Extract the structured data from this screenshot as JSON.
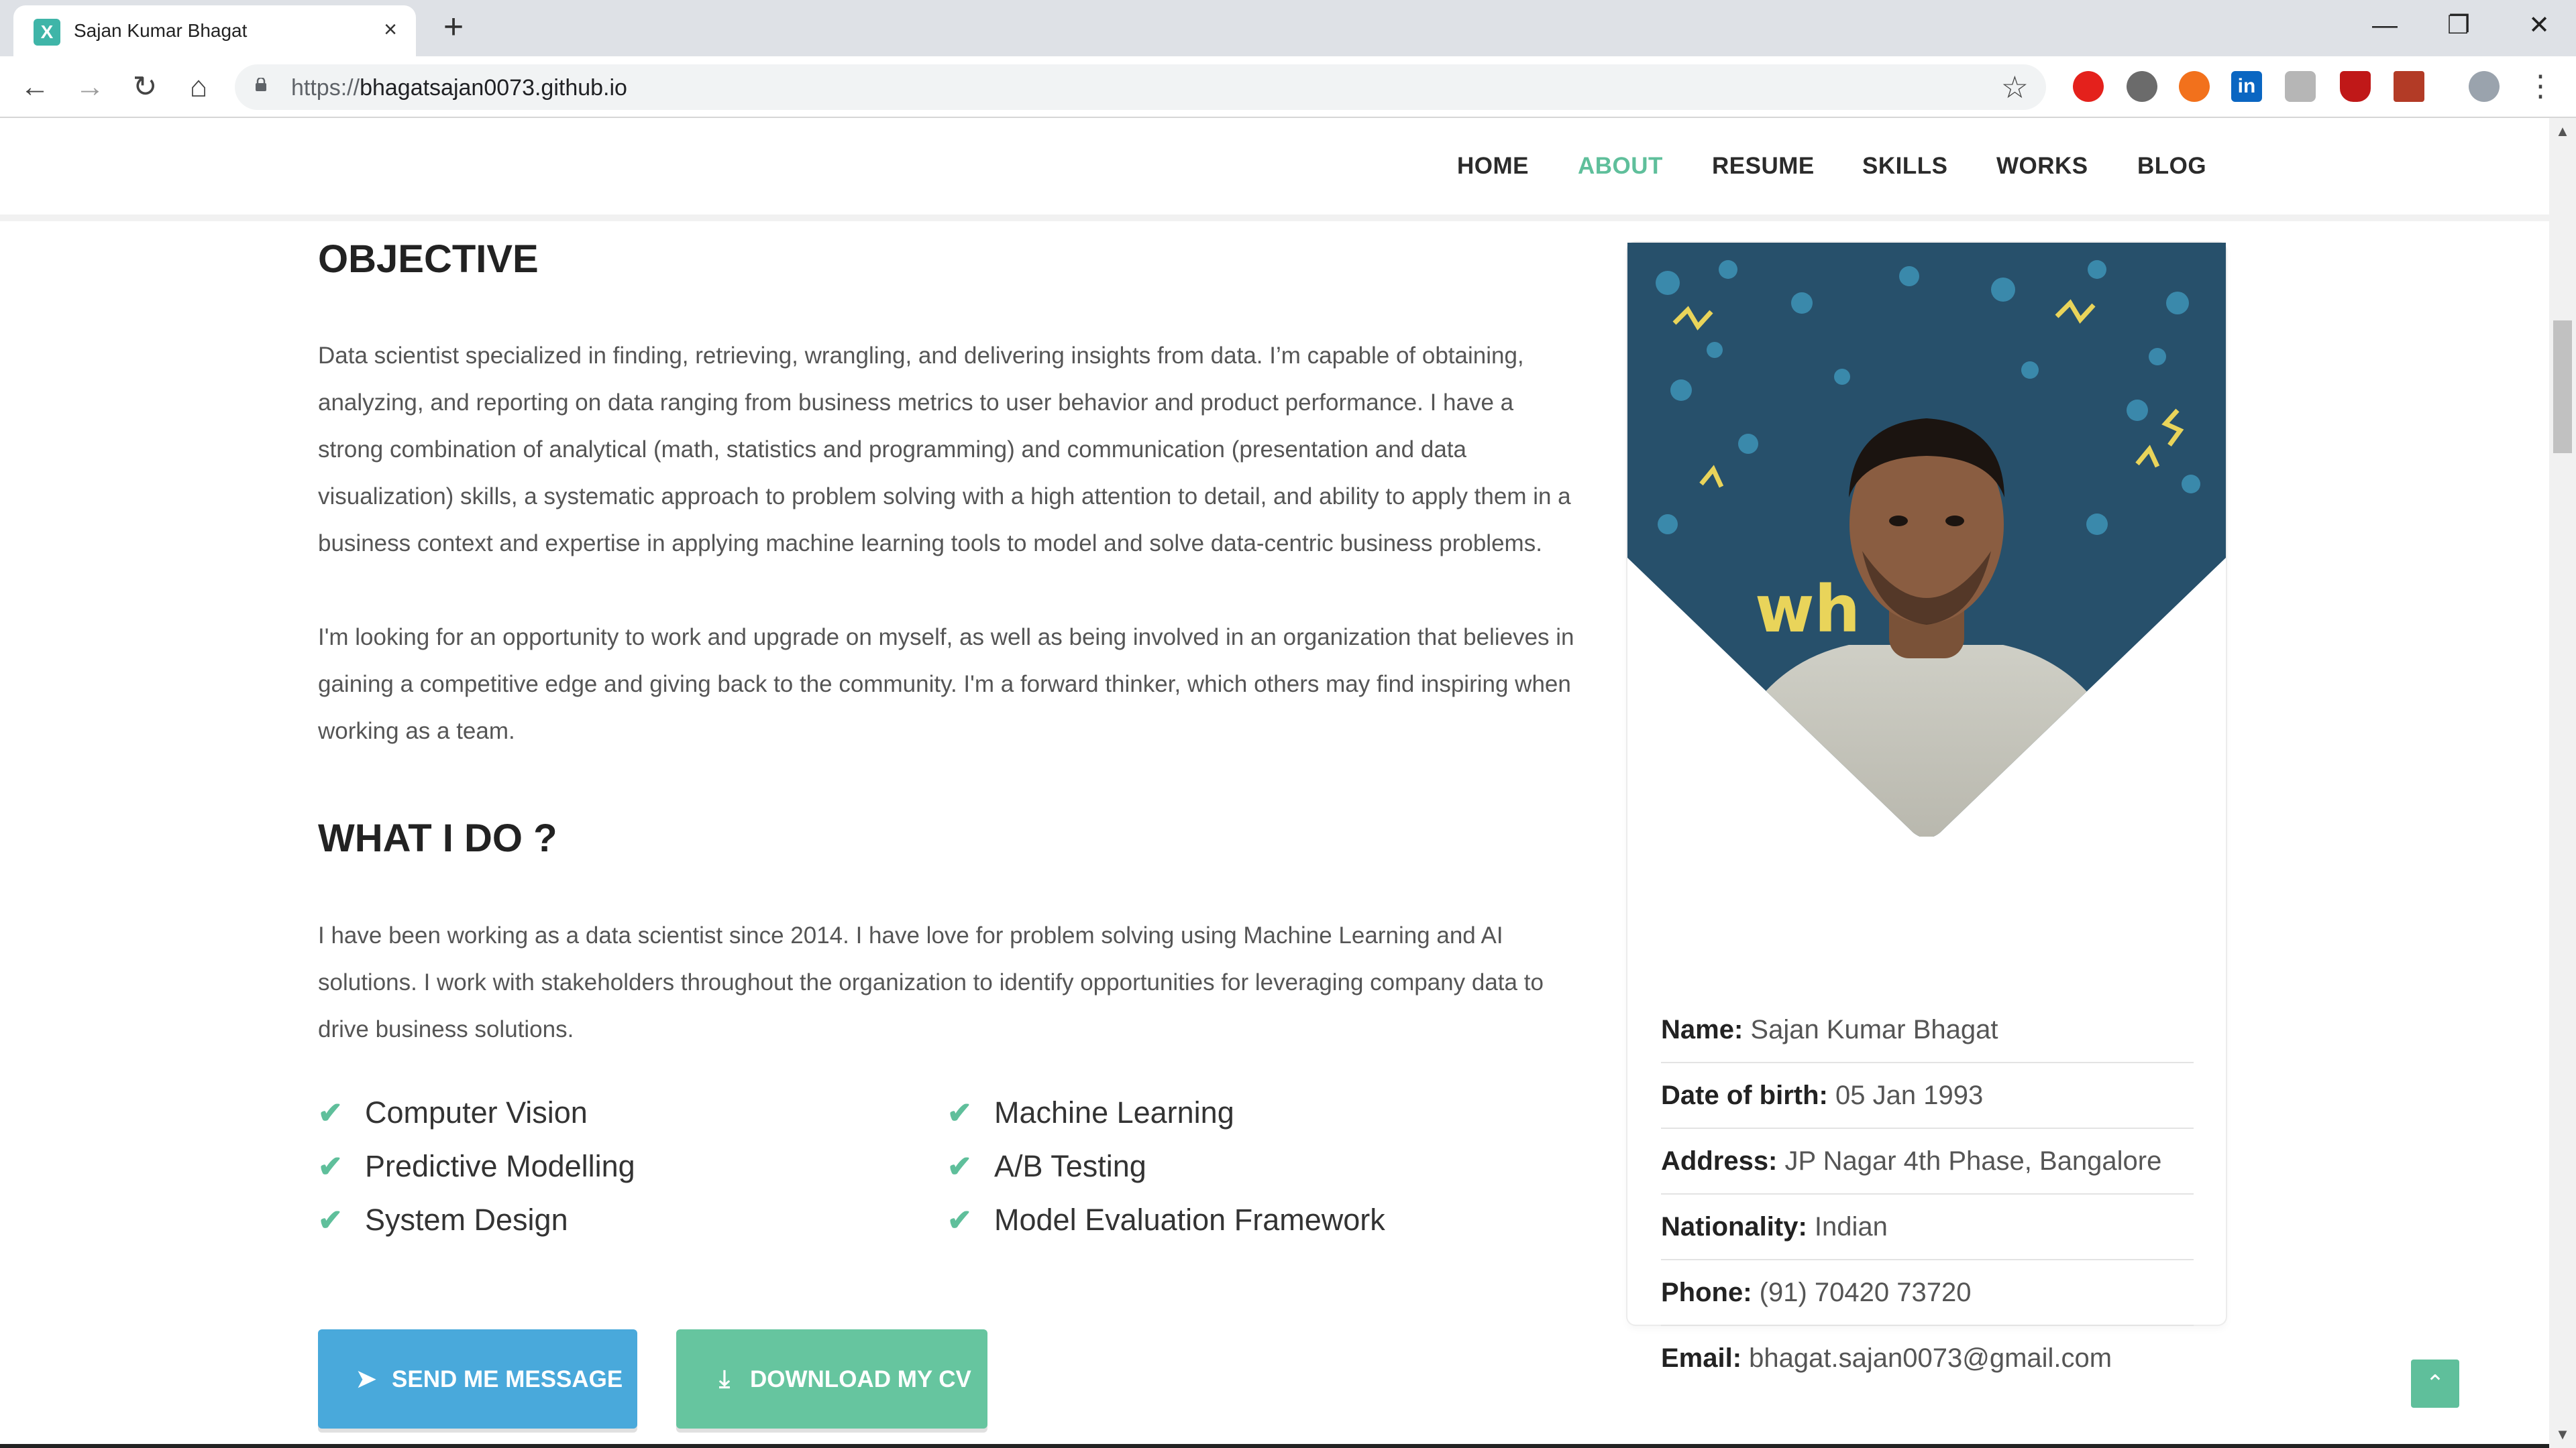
{
  "browser": {
    "tab_title": "Sajan Kumar Bhagat",
    "tab_favicon_letter": "X",
    "tab_close": "×",
    "new_tab": "+",
    "url_protocol": "https://",
    "url_host": "bhagatsajan0073.github.io",
    "window_controls": {
      "minimize": "—",
      "maximize": "❐",
      "close": "✕"
    },
    "nav_icons": {
      "back": "←",
      "forward": "→",
      "reload": "↻",
      "home": "⌂",
      "star": "☆",
      "menu": "⋮"
    },
    "extension_icons": [
      "adblock-icon",
      "circle-extension-icon",
      "orange-extension-icon",
      "linkedin-icon",
      "chat-extension-icon",
      "mcafee-icon",
      "pdf-icon",
      "profile-avatar"
    ],
    "linkedin_letter": "in"
  },
  "nav": {
    "items": [
      "HOME",
      "ABOUT",
      "RESUME",
      "SKILLS",
      "WORKS",
      "BLOG"
    ],
    "active": "ABOUT"
  },
  "objective": {
    "title": "OBJECTIVE",
    "p1": "Data scientist specialized in finding, retrieving, wrangling, and delivering insights from data. I’m capable of obtaining, analyzing, and reporting on data ranging from business metrics to user behavior and product performance. I have a strong combination of analytical (math, statistics and programming) and communication (presentation and data visualization) skills, a systematic approach to problem solving with a high attention to detail, and ability to apply them in a business context and expertise in applying machine learning tools to model and solve data-centric business problems.",
    "p2": "I'm looking for an opportunity to work and upgrade on myself, as well as being involved in an organization that believes in gaining a competitive edge and giving back to the community. I'm a forward thinker, which others may find inspiring when working as a team."
  },
  "whatido": {
    "title": "WHAT I DO ?",
    "p1": "I have been working as a data scientist since 2014. I have love for problem solving using Machine Learning and AI solutions. I work with stakeholders throughout the organization to identify opportunities for leveraging company data to drive business solutions.",
    "skills_left": [
      "Computer Vision",
      "Predictive Modelling",
      "System Design"
    ],
    "skills_right": [
      "Machine Learning",
      "A/B Testing",
      "Model Evaluation Framework"
    ],
    "check_glyph": "✔"
  },
  "buttons": {
    "send": "SEND ME MESSAGE",
    "send_icon": "➤",
    "cv": "DOWNLOAD MY CV",
    "cv_icon": "⤓"
  },
  "profile": {
    "photo_overlay_text": "wh",
    "rows": [
      {
        "label": "Name:",
        "value": "Sajan Kumar Bhagat"
      },
      {
        "label": "Date of birth:",
        "value": "05 Jan 1993"
      },
      {
        "label": "Address:",
        "value": "JP Nagar 4th Phase, Bangalore"
      },
      {
        "label": "Nationality:",
        "value": "Indian"
      },
      {
        "label": "Phone:",
        "value": "(91) 70420 73720"
      },
      {
        "label": "Email:",
        "value": "bhagat.sajan0073@gmail.com"
      }
    ]
  },
  "scroll_top_icon": "⌃",
  "colors": {
    "accent": "#5fbf9b",
    "send_button": "#49a9db",
    "cv_button": "#66c59f",
    "heading": "#222222",
    "body_text": "#555555"
  }
}
